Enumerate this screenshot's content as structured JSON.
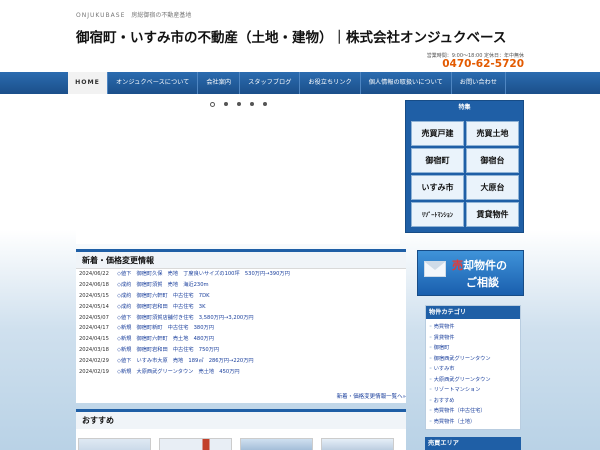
{
  "header": {
    "tagline": "ONJUKUBASE",
    "tagline_sub": "房総御宿の不動産基地",
    "title": "御宿町・いすみ市の不動産（土地・建物）｜株式会社オンジュクベース",
    "hours": "営業時間：9:00～18:00 定休日：年中無休",
    "phone": "0470-62-5720"
  },
  "nav": {
    "items": [
      {
        "label": "HOME"
      },
      {
        "label": "オンジュクベースについて"
      },
      {
        "label": "会社案内"
      },
      {
        "label": "スタッフブログ"
      },
      {
        "label": "お役立ちリンク"
      },
      {
        "label": "個人情報の取扱いについて"
      },
      {
        "label": "お問い合わせ"
      }
    ]
  },
  "feature": {
    "title": "特集",
    "buttons": [
      "売買戸建",
      "売買土地",
      "御宿町",
      "御宿台",
      "いすみ市",
      "大原台",
      "ﾘｿﾞｰﾄﾏﾝｼｮﾝ",
      "賃貸物件"
    ]
  },
  "news": {
    "title": "新着・価格変更情報",
    "items": [
      {
        "date": "2024/06/22",
        "text": "◇値下　御宿町久保　売地　丁度良いサイズの100坪　530万円→390万円"
      },
      {
        "date": "2024/06/18",
        "text": "◇成約　御宿町須賀　売地　海近230m"
      },
      {
        "date": "2024/05/15",
        "text": "◇成約　御宿町六軒町　中古住宅　7DK"
      },
      {
        "date": "2024/05/14",
        "text": "◇成約　御宿町岩和田　中古住宅　3K"
      },
      {
        "date": "2024/05/07",
        "text": "◇値下　御宿町須賀店舗付き住宅　3,580万円→3,200万円"
      },
      {
        "date": "2024/04/17",
        "text": "◇新規　御宿町新町　中古住宅　380万円"
      },
      {
        "date": "2024/04/15",
        "text": "◇新規　御宿町六軒町　売土地　480万円"
      },
      {
        "date": "2024/03/18",
        "text": "◇新規　御宿町岩和田　中古住宅　750万円"
      },
      {
        "date": "2024/02/29",
        "text": "◇値下　いすみ市大原　売地　189㎡　286万円→220万円"
      },
      {
        "date": "2024/02/19",
        "text": "◇新規　大原西武グリーンタウン　売土地　450万円"
      }
    ],
    "more": "新着・価格変更情報一覧へ»"
  },
  "recommend": {
    "title": "おすすめ"
  },
  "banner": {
    "line1_red": "売",
    "line1_rest": "却物件の",
    "line2": "ご相談"
  },
  "category": {
    "title": "物件カテゴリ",
    "items": [
      "売買物件",
      "賃貸物件",
      "御宿町",
      "御宿西武グリーンタウン",
      "いすみ市",
      "大原西武グリーンタウン",
      "リゾートマンション",
      "おすすめ",
      "売買物件（中古住宅）",
      "売買物件（土地）"
    ]
  },
  "area": {
    "title": "売買エリア"
  },
  "slider": {
    "dots": 5,
    "active_index": 0
  }
}
